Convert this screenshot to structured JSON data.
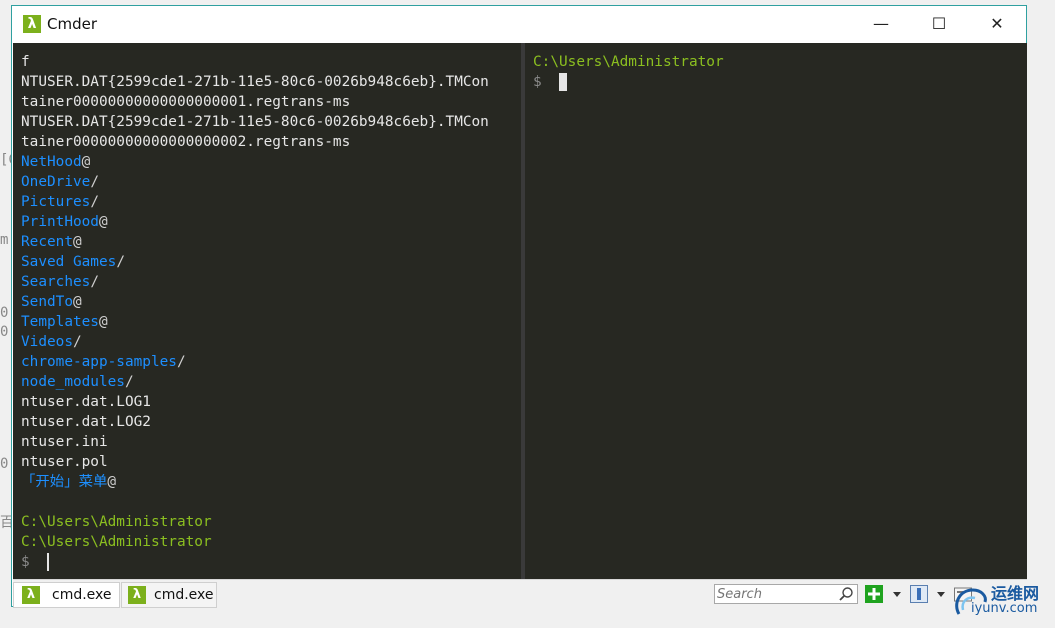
{
  "window": {
    "title": "Cmder",
    "app_icon": "λ",
    "minimize_symbol": "—",
    "maximize_symbol": "☐",
    "close_symbol": "✕"
  },
  "left_pane": {
    "lines": [
      {
        "text": "f",
        "type": "file"
      },
      {
        "text": "NTUSER.DAT{2599cde1-271b-11e5-80c6-0026b948c6eb}.TMCon",
        "type": "file"
      },
      {
        "text": "tainer00000000000000000001.regtrans-ms",
        "type": "file"
      },
      {
        "text": "NTUSER.DAT{2599cde1-271b-11e5-80c6-0026b948c6eb}.TMCon",
        "type": "file"
      },
      {
        "text": "tainer00000000000000000002.regtrans-ms",
        "type": "file"
      },
      {
        "text": "NetHood",
        "suffix": "@",
        "type": "dir"
      },
      {
        "text": "OneDrive",
        "suffix": "/",
        "type": "dir"
      },
      {
        "text": "Pictures",
        "suffix": "/",
        "type": "dir"
      },
      {
        "text": "PrintHood",
        "suffix": "@",
        "type": "dir"
      },
      {
        "text": "Recent",
        "suffix": "@",
        "type": "dir"
      },
      {
        "text": "Saved Games",
        "suffix": "/",
        "type": "dir"
      },
      {
        "text": "Searches",
        "suffix": "/",
        "type": "dir"
      },
      {
        "text": "SendTo",
        "suffix": "@",
        "type": "dir"
      },
      {
        "text": "Templates",
        "suffix": "@",
        "type": "dir"
      },
      {
        "text": "Videos",
        "suffix": "/",
        "type": "dir"
      },
      {
        "text": "chrome-app-samples",
        "suffix": "/",
        "type": "dir"
      },
      {
        "text": "node_modules",
        "suffix": "/",
        "type": "dir"
      },
      {
        "text": "ntuser.dat.LOG1",
        "type": "file"
      },
      {
        "text": "ntuser.dat.LOG2",
        "type": "file"
      },
      {
        "text": "ntuser.ini",
        "type": "file"
      },
      {
        "text": "ntuser.pol",
        "type": "file"
      },
      {
        "text": "「开始」菜单",
        "suffix": "@",
        "type": "dir"
      },
      {
        "text": "",
        "type": "blank"
      },
      {
        "text": "C:\\Users\\Administrator",
        "type": "path"
      },
      {
        "text": "C:\\Users\\Administrator",
        "type": "path"
      },
      {
        "text": "$",
        "type": "prompt"
      }
    ]
  },
  "right_pane": {
    "path": "C:\\Users\\Administrator",
    "prompt": "$"
  },
  "statusbar": {
    "tabs": [
      {
        "icon": "λ",
        "label": "cmd.exe"
      },
      {
        "icon": "λ",
        "label": "cmd.exe"
      }
    ],
    "search_placeholder": "Search"
  },
  "background_fragments": [
    "[C",
    "m",
    "0",
    "0",
    "0",
    "百"
  ],
  "watermark": {
    "title": "运维网",
    "url": "iyunv.com"
  },
  "colors": {
    "terminal_bg": "#272822",
    "dir": "#1d8fff",
    "path": "#8bbf20",
    "accent": "#7cb01c"
  }
}
